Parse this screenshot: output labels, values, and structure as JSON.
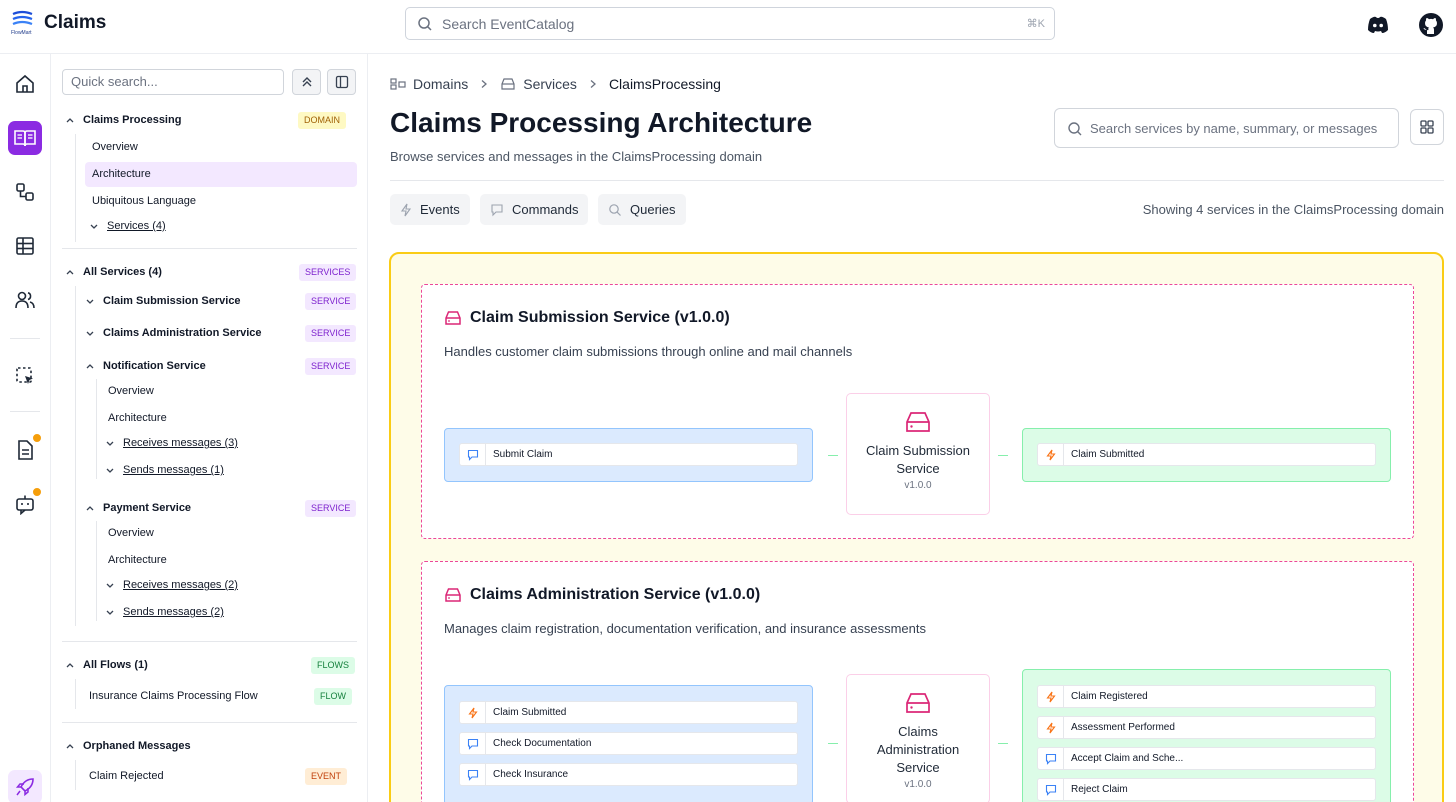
{
  "header": {
    "app_title": "Claims",
    "logo_text": "FlowMart",
    "search_placeholder": "Search EventCatalog",
    "search_shortcut": "⌘K",
    "icons": [
      "discord-icon",
      "github-icon"
    ]
  },
  "rail": {
    "items": [
      "home-icon",
      "docs-icon",
      "visualizer-icon",
      "table-icon",
      "users-icon",
      "selection-icon",
      "notes-icon",
      "chat-bot-icon",
      "rocket-icon"
    ],
    "active": "docs-icon"
  },
  "sidebar": {
    "quick_search_placeholder": "Quick search...",
    "domain": {
      "label": "Claims Processing",
      "badge": "DOMAIN",
      "items": [
        "Overview",
        "Architecture",
        "Ubiquitous Language"
      ],
      "services_link": "Services (4)",
      "active_item": "Architecture"
    },
    "all_services": {
      "label": "All Services (4)",
      "badge": "SERVICES",
      "services": [
        {
          "label": "Claim Submission Service",
          "badge": "SERVICE"
        },
        {
          "label": "Claims Administration Service",
          "badge": "SERVICE"
        },
        {
          "label": "Notification Service",
          "badge": "SERVICE",
          "items": [
            "Overview",
            "Architecture"
          ],
          "receives": "Receives messages (3)",
          "sends": "Sends messages (1)"
        },
        {
          "label": "Payment Service",
          "badge": "SERVICE",
          "items": [
            "Overview",
            "Architecture"
          ],
          "receives": "Receives messages (2)",
          "sends": "Sends messages (2)"
        }
      ]
    },
    "flows": {
      "label": "All Flows (1)",
      "badge": "FLOWS",
      "item": "Insurance Claims Processing Flow",
      "item_badge": "FLOW"
    },
    "orphaned": {
      "label": "Orphaned Messages",
      "item": "Claim Rejected",
      "item_badge": "EVENT"
    }
  },
  "main": {
    "breadcrumbs": [
      "Domains",
      "Services",
      "ClaimsProcessing"
    ],
    "title": "Claims Processing Architecture",
    "subtitle": "Browse services and messages in the ClaimsProcessing domain",
    "service_search_placeholder": "Search services by name, summary, or messages",
    "filters": [
      "Events",
      "Commands",
      "Queries"
    ],
    "showing": "Showing 4 services in the ClaimsProcessing domain",
    "services": [
      {
        "title": "Claim Submission Service (v1.0.0)",
        "description": "Handles customer claim submissions through online and mail channels",
        "node_name": "Claim Submission Service",
        "node_version": "v1.0.0",
        "receives": [
          {
            "type": "command",
            "name": "Submit Claim"
          }
        ],
        "sends": [
          {
            "type": "event",
            "name": "Claim Submitted"
          }
        ]
      },
      {
        "title": "Claims Administration Service (v1.0.0)",
        "description": "Manages claim registration, documentation verification, and insurance assessments",
        "node_name": "Claims Administration Service",
        "node_version": "v1.0.0",
        "receives": [
          {
            "type": "event",
            "name": "Claim Submitted"
          },
          {
            "type": "command",
            "name": "Check Documentation"
          },
          {
            "type": "command",
            "name": "Check Insurance"
          }
        ],
        "sends": [
          {
            "type": "event",
            "name": "Claim Registered"
          },
          {
            "type": "event",
            "name": "Assessment Performed"
          },
          {
            "type": "command",
            "name": "Accept Claim and Sche..."
          },
          {
            "type": "command",
            "name": "Reject Claim"
          }
        ]
      }
    ]
  },
  "colors": {
    "accent": "#8b2be2",
    "canvas_border": "#facc15",
    "canvas_bg": "#fefce8",
    "service_border": "#ec4899",
    "event": "#f97316",
    "command": "#3b82f6"
  }
}
